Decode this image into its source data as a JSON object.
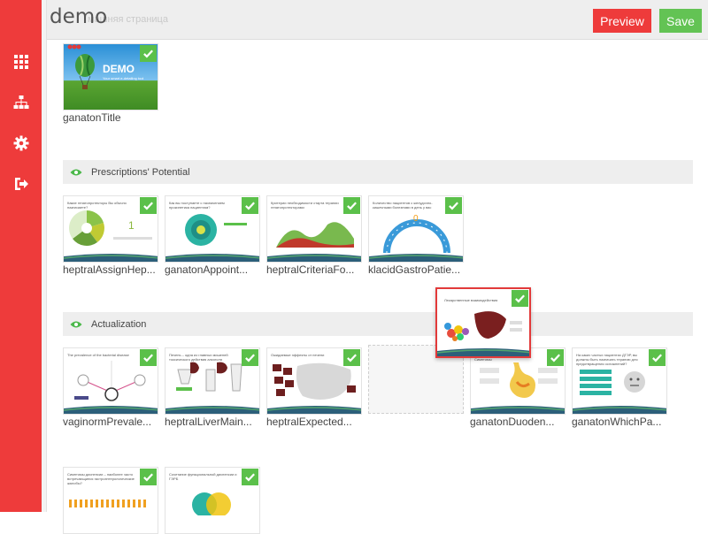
{
  "app": {
    "title": "demo",
    "subtitle": "машняя страница"
  },
  "toolbar": {
    "preview_label": "Preview",
    "save_label": "Save"
  },
  "sidebar": {
    "items": [
      {
        "icon": "grid-icon"
      },
      {
        "icon": "sitemap-icon"
      },
      {
        "icon": "gear-icon"
      },
      {
        "icon": "sign-out-icon"
      }
    ]
  },
  "colors": {
    "sidebar": "#ee3b3b",
    "preview_button": "#ee3b3b",
    "save_button": "#63c354",
    "check_badge": "#5bc04a",
    "section_eye": "#4bb84a"
  },
  "title_slide": {
    "caption": "ganatonTitle",
    "thumb_text": "DEMO",
    "thumb_sub": "Your smart e-detailing tool"
  },
  "sections": [
    {
      "label": "Prescriptions' Potential",
      "slides": [
        {
          "caption": "heptralAssignHep...",
          "thumb_title": "Какие гепатопротекторы Вы обычно назначаете?",
          "big_number": "1"
        },
        {
          "caption": "ganatonAppoint...",
          "thumb_title": "Как вы поступаете с назначением прокинетика пациентам?"
        },
        {
          "caption": "heptralCriteriaFo...",
          "thumb_title": "Критерии необходимости старта терапии гепатопротекторами"
        },
        {
          "caption": "klacidGastroPatie...",
          "thumb_title": "Количество пациентов с желудочно-кишечными болезнями в день у вас",
          "big_number": "0"
        }
      ]
    },
    {
      "label": "Actualization",
      "slides": [
        {
          "caption": "vaginormPrevale...",
          "thumb_title": "The prevalence of the bacterial disease"
        },
        {
          "caption": "heptralLiverMain...",
          "thumb_title": "Печень – одна из главных мишеней токсического действия алкоголя"
        },
        {
          "caption": "heptralExpected...",
          "thumb_title": "Ожидаемые эффекты от печени"
        },
        {
          "caption": "ganatonDuoden...",
          "thumb_title": "Дуоденогастральный рефлюкс. Симптомы"
        },
        {
          "caption": "ganatonWhichPa...",
          "thumb_title": "На каких частых пациентах ДГЭР, вы должны быть назначать терапию для предотвращения осложнений?"
        }
      ]
    },
    {
      "label": "",
      "slides": [
        {
          "caption": "",
          "thumb_title": "Симптомы диспепсии – наиболее часто встречающиеся гастроэнтерологические жалобы?"
        },
        {
          "caption": "",
          "thumb_title": "Сочетание функциональной диспепсии и ГЭРБ"
        }
      ]
    }
  ],
  "dragging_slide": {
    "thumb_title": "Лекарственные взаимодействия"
  }
}
